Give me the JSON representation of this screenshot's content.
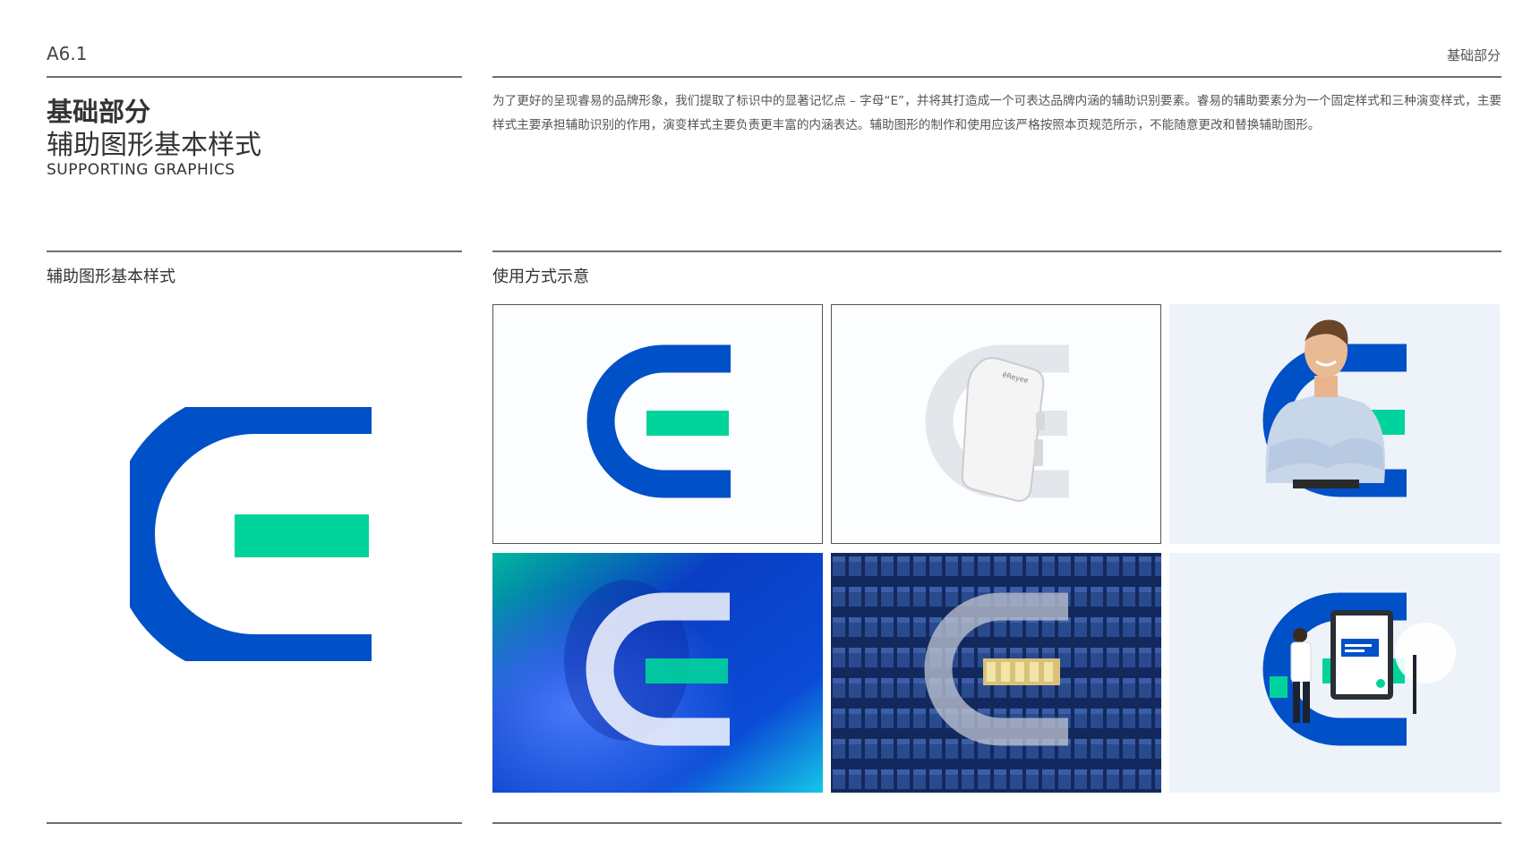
{
  "header": {
    "page_code": "A6.1",
    "section": "基础部分"
  },
  "title": {
    "line1": "基础部分",
    "line2": "辅助图形基本样式",
    "english": "SUPPORTING GRAPHICS"
  },
  "intro": "为了更好的呈现睿易的品牌形象，我们提取了标识中的显著记忆点 – 字母“E”，并将其打造成一个可表达品牌内涵的辅助识别要素。睿易的辅助要素分为一个固定样式和三种演变样式，主要样式主要承担辅助识别的作用，演变样式主要负责更丰富的内涵表达。辅助图形的制作和使用应该严格按照本页规范所示，不能随意更改和替换辅助图形。",
  "left_section": {
    "label": "辅助图形基本样式"
  },
  "right_section": {
    "label": "使用方式示意"
  },
  "device_label": "ēReyee",
  "colors": {
    "brand_blue": "#0050c8",
    "brand_green": "#00d49c",
    "light_gray": "#e3e6ea",
    "panel_tint": "#eef3fa",
    "night_navy": "#13295e"
  }
}
